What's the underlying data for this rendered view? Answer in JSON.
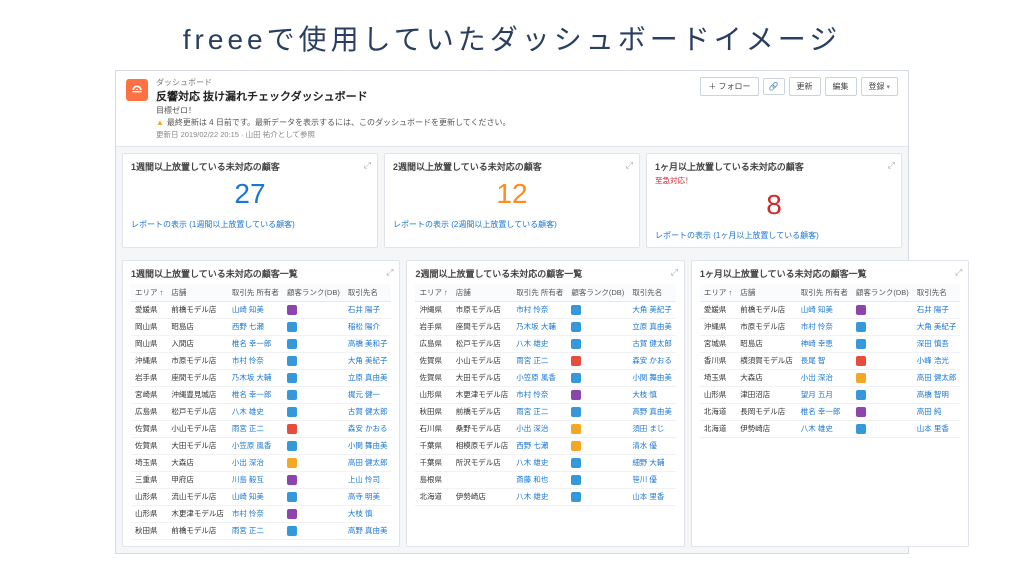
{
  "page": {
    "title": "freeeで使用していたダッシュボードイメージ"
  },
  "header": {
    "breadcrumb": "ダッシュボード",
    "title": "反響対応 抜け漏れチェックダッシュボード",
    "subtitle": "目標ゼロ！",
    "warning": "最終更新は 4 日前です。最新データを表示するには、このダッシュボードを更新してください。",
    "meta": "更新日 2019/02/22 20:15 · 山田 祐介として参照",
    "actions": {
      "follow": "＋ フォロー",
      "link": "🔗",
      "refresh": "更新",
      "edit": "編集",
      "register": "登録"
    }
  },
  "metrics": [
    {
      "title": "1週間以上放置している未対応の顧客",
      "value": "27",
      "color": "blue",
      "link": "レポートの表示 (1週間以上放置している顧客)"
    },
    {
      "title": "2週間以上放置している未対応の顧客",
      "value": "12",
      "color": "orange",
      "link": "レポートの表示 (2週間以上放置している顧客)"
    },
    {
      "title": "1ヶ月以上放置している未対応の顧客",
      "sub": "至急対応！",
      "value": "8",
      "color": "red",
      "link": "レポートの表示 (1ヶ月以上放置している顧客)"
    }
  ],
  "tables": [
    {
      "title": "1週間以上放置している未対応の顧客一覧",
      "cols": [
        "エリア ↑",
        "店舗",
        "取引先 所有者",
        "顧客ランク(DB)",
        "取引先名"
      ],
      "rows": [
        [
          "愛媛県",
          "前橋モデル店",
          "山崎 知美",
          "D",
          "石井 陽子"
        ],
        [
          "岡山県",
          "昭島店",
          "西野 七瀬",
          "C",
          "稲松 陽介"
        ],
        [
          "岡山県",
          "入間店",
          "椎名 幸一郎",
          "C",
          "高橋 美和子"
        ],
        [
          "沖縄県",
          "市原モデル店",
          "市村 怜奈",
          "C",
          "大角 美紀子"
        ],
        [
          "岩手県",
          "座間モデル店",
          "乃木坂 大輔",
          "C",
          "立原 真由美"
        ],
        [
          "宮崎県",
          "沖縄豊見城店",
          "椎名 幸一郎",
          "C",
          "梶元 健一"
        ],
        [
          "広島県",
          "松戸モデル店",
          "八木 雄史",
          "C",
          "古賀 健太郎"
        ],
        [
          "佐賀県",
          "小山モデル店",
          "雨宮 正二",
          "A",
          "森安 かおる"
        ],
        [
          "佐賀県",
          "大田モデル店",
          "小笠原 風香",
          "C",
          "小関 舞由美"
        ],
        [
          "埼玉県",
          "大森店",
          "小出 深治",
          "B",
          "高田 健太郎"
        ],
        [
          "三重県",
          "甲府店",
          "川島 毅互",
          "D",
          "上山 怜司"
        ],
        [
          "山形県",
          "流山モデル店",
          "山崎 知美",
          "C",
          "高寺 明美"
        ],
        [
          "山形県",
          "木更津モデル店",
          "市村 怜奈",
          "D",
          "大枝 慎"
        ],
        [
          "秋田県",
          "前橋モデル店",
          "雨宮 正二",
          "C",
          "高野 真由美"
        ]
      ]
    },
    {
      "title": "2週間以上放置している未対応の顧客一覧",
      "cols": [
        "エリア ↑",
        "店舗",
        "取引先 所有者",
        "顧客ランク(DB)",
        "取引先名"
      ],
      "rows": [
        [
          "沖縄県",
          "市原モデル店",
          "市村 怜奈",
          "C",
          "大角 美紀子"
        ],
        [
          "岩手県",
          "座間モデル店",
          "乃木坂 大輔",
          "C",
          "立原 真由美"
        ],
        [
          "広島県",
          "松戸モデル店",
          "八木 雄史",
          "C",
          "古賀 健太郎"
        ],
        [
          "佐賀県",
          "小山モデル店",
          "雨宮 正二",
          "A",
          "森安 かおる"
        ],
        [
          "佐賀県",
          "大田モデル店",
          "小笠原 風香",
          "C",
          "小関 舞由美"
        ],
        [
          "山形県",
          "木更津モデル店",
          "市村 怜奈",
          "D",
          "大枝 慎"
        ],
        [
          "秋田県",
          "前橋モデル店",
          "雨宮 正二",
          "C",
          "高野 真由美"
        ],
        [
          "石川県",
          "桑野モデル店",
          "小出 深治",
          "B",
          "須田 まじ"
        ],
        [
          "千葉県",
          "相模原モデル店",
          "西野 七瀬",
          "B",
          "清水 優"
        ],
        [
          "千葉県",
          "所沢モデル店",
          "八木 雄史",
          "C",
          "細野 大輔"
        ],
        [
          "島根県",
          "",
          "斎藤 和也",
          "C",
          "笹川 優"
        ],
        [
          "北海道",
          "伊勢崎店",
          "八木 雄史",
          "C",
          "山本 里香"
        ]
      ]
    },
    {
      "title": "1ヶ月以上放置している未対応の顧客一覧",
      "cols": [
        "エリア ↑",
        "店舗",
        "取引先 所有者",
        "顧客ランク(DB)",
        "取引先名"
      ],
      "rows": [
        [
          "愛媛県",
          "前橋モデル店",
          "山崎 知美",
          "D",
          "石井 陽子"
        ],
        [
          "沖縄県",
          "市原モデル店",
          "市村 怜奈",
          "C",
          "大角 美紀子"
        ],
        [
          "宮城県",
          "昭島店",
          "神崎 幸恵",
          "C",
          "深田 慎吾"
        ],
        [
          "香川県",
          "横須賀モデル店",
          "長尾 智",
          "A",
          "小峰 浩光"
        ],
        [
          "埼玉県",
          "大森店",
          "小出 深治",
          "B",
          "高田 健太郎"
        ],
        [
          "山形県",
          "津田沼店",
          "望月 五月",
          "C",
          "高橋 智明"
        ],
        [
          "北海道",
          "長岡モデル店",
          "椎名 幸一郎",
          "D",
          "高田 純"
        ],
        [
          "北海道",
          "伊勢崎店",
          "八木 雄史",
          "C",
          "山本 里香"
        ]
      ]
    }
  ]
}
